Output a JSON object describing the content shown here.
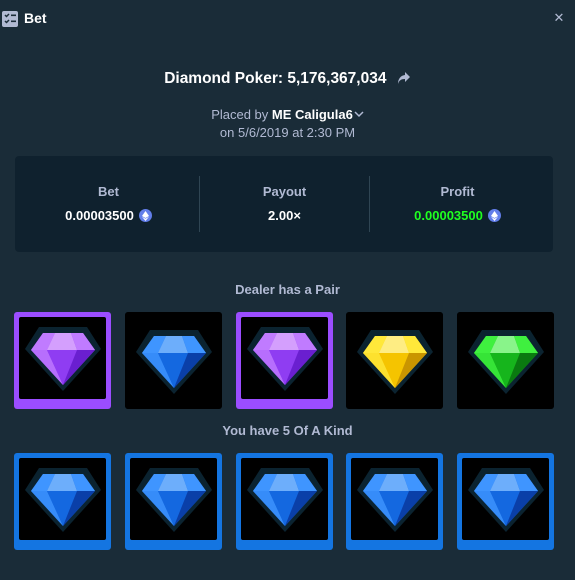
{
  "header": {
    "title": "Bet",
    "icon": "bet-list-icon",
    "close_icon": "close-icon"
  },
  "game": {
    "title": "Diamond Poker: 5,176,367,034",
    "share_icon": "share-arrow-icon"
  },
  "placed": {
    "prefix": "Placed by ",
    "user": "ME Caligula6",
    "date": "on 5/6/2019 at 2:30 PM"
  },
  "stats": {
    "bet": {
      "label": "Bet",
      "value": "0.00003500",
      "currency": "eth-icon"
    },
    "payout": {
      "label": "Payout",
      "value": "2.00×"
    },
    "profit": {
      "label": "Profit",
      "value": "0.00003500",
      "currency": "eth-icon",
      "color": "#1fff20"
    }
  },
  "dealer": {
    "label": "Dealer has a Pair",
    "cards": [
      {
        "gem": "purple",
        "highlighted": true
      },
      {
        "gem": "blue",
        "highlighted": false
      },
      {
        "gem": "purple",
        "highlighted": true
      },
      {
        "gem": "yellow",
        "highlighted": false
      },
      {
        "gem": "green",
        "highlighted": false
      }
    ]
  },
  "player": {
    "label": "You have 5 Of A Kind",
    "cards": [
      {
        "gem": "blue",
        "highlighted": true
      },
      {
        "gem": "blue",
        "highlighted": true
      },
      {
        "gem": "blue",
        "highlighted": true
      },
      {
        "gem": "blue",
        "highlighted": true
      },
      {
        "gem": "blue",
        "highlighted": true
      }
    ]
  },
  "colors": {
    "background": "#1a2c38",
    "panel": "#0f212e",
    "purple_frame": "#9b4dff",
    "blue_frame": "#1475e1",
    "profit_green": "#1fff20"
  }
}
